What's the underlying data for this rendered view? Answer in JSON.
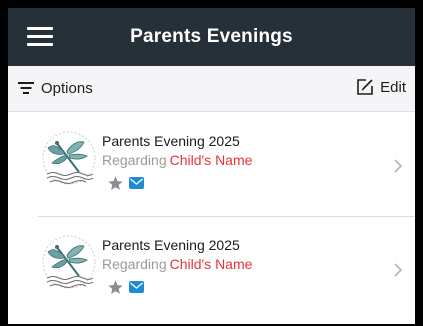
{
  "header": {
    "title": "Parents Evenings"
  },
  "toolbar": {
    "options_label": "Options",
    "edit_label": "Edit"
  },
  "list": {
    "items": [
      {
        "title": "Parents Evening 2025",
        "regarding_label": "Regarding",
        "child_name": "Child's Name"
      },
      {
        "title": "Parents Evening 2025",
        "regarding_label": "Regarding",
        "child_name": "Child's Name"
      }
    ]
  },
  "colors": {
    "header_bg": "#263038",
    "accent_red": "#e8333a",
    "mail_blue": "#1f8ad4",
    "star_grey": "#8a8f95",
    "logo_teal": "#4f8a8b"
  },
  "icons": {
    "menu": "hamburger-icon",
    "options": "filter-icon",
    "edit": "compose-icon",
    "logo": "school-logo-dragonfly",
    "star": "star-icon",
    "mail": "mail-icon",
    "chevron": "chevron-right-icon"
  }
}
